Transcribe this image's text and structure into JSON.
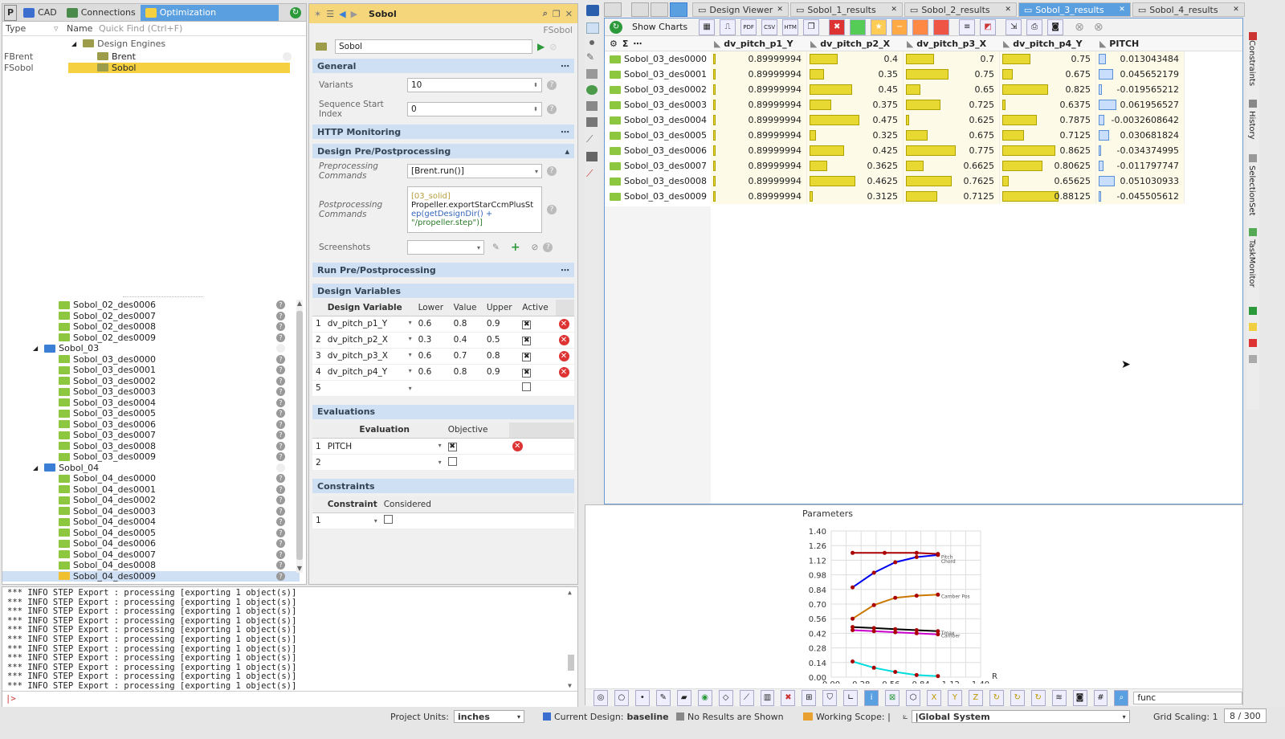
{
  "left": {
    "tabs": [
      "P",
      "CAD",
      "Connections",
      "Optimization"
    ],
    "tree_header": {
      "type": "Type",
      "name": "Name",
      "quick_find": "Quick Find (Ctrl+F)"
    },
    "engines": {
      "root": "Design Engines",
      "items": [
        {
          "type": "FBrent",
          "name": "Brent"
        },
        {
          "type": "FSobol",
          "name": "Sobol"
        }
      ]
    },
    "designs": [
      {
        "name": "Sobol_02_des0006",
        "kind": "item"
      },
      {
        "name": "Sobol_02_des0007",
        "kind": "item"
      },
      {
        "name": "Sobol_02_des0008",
        "kind": "item"
      },
      {
        "name": "Sobol_02_des0009",
        "kind": "item"
      },
      {
        "name": "Sobol_03",
        "kind": "group"
      },
      {
        "name": "Sobol_03_des0000",
        "kind": "item"
      },
      {
        "name": "Sobol_03_des0001",
        "kind": "item"
      },
      {
        "name": "Sobol_03_des0002",
        "kind": "item"
      },
      {
        "name": "Sobol_03_des0003",
        "kind": "item"
      },
      {
        "name": "Sobol_03_des0004",
        "kind": "item"
      },
      {
        "name": "Sobol_03_des0005",
        "kind": "item"
      },
      {
        "name": "Sobol_03_des0006",
        "kind": "item"
      },
      {
        "name": "Sobol_03_des0007",
        "kind": "item"
      },
      {
        "name": "Sobol_03_des0008",
        "kind": "item"
      },
      {
        "name": "Sobol_03_des0009",
        "kind": "item"
      },
      {
        "name": "Sobol_04",
        "kind": "group"
      },
      {
        "name": "Sobol_04_des0000",
        "kind": "item"
      },
      {
        "name": "Sobol_04_des0001",
        "kind": "item"
      },
      {
        "name": "Sobol_04_des0002",
        "kind": "item"
      },
      {
        "name": "Sobol_04_des0003",
        "kind": "item"
      },
      {
        "name": "Sobol_04_des0004",
        "kind": "item"
      },
      {
        "name": "Sobol_04_des0005",
        "kind": "item"
      },
      {
        "name": "Sobol_04_des0006",
        "kind": "item"
      },
      {
        "name": "Sobol_04_des0007",
        "kind": "item"
      },
      {
        "name": "Sobol_04_des0008",
        "kind": "item"
      },
      {
        "name": "Sobol_04_des0009",
        "kind": "item"
      }
    ]
  },
  "console": {
    "lines": [
      "*** INFO STEP Export : processing [exporting 1 object(s)]",
      "*** INFO STEP Export : processing [exporting 1 object(s)]",
      "*** INFO STEP Export : processing [exporting 1 object(s)]",
      "*** INFO STEP Export : processing [exporting 1 object(s)]",
      "*** INFO STEP Export : processing [exporting 1 object(s)]",
      "*** INFO STEP Export : processing [exporting 1 object(s)]",
      "*** INFO STEP Export : processing [exporting 1 object(s)]",
      "*** INFO STEP Export : processing [exporting 1 object(s)]",
      "*** INFO STEP Export : processing [exporting 1 object(s)]",
      "*** INFO STEP Export : processing [exporting 1 object(s)]",
      "*** INFO STEP Export : processing [exporting 1 object(s)]"
    ],
    "prompt": "|>"
  },
  "mid": {
    "title": "Sobol",
    "class_label": "FSobol",
    "name_value": "Sobol",
    "general": "General",
    "variants_label": "Variants",
    "variants_value": "10",
    "seq_label": "Sequence Start Index",
    "seq_value": "0",
    "http": "HTTP Monitoring",
    "prepost": "Design Pre/Postprocessing",
    "pre_label": "Preprocessing Commands",
    "pre_value": "[Brent.run()]",
    "post_label": "Postprocessing Commands",
    "post_value_1": "[03_solid]",
    "post_value_2": "Propeller.exportStarCcmPlusSt",
    "post_value_3": "ep(getDesignDir() +",
    "post_value_4": "\"/propeller.step\")]",
    "screenshots_label": "Screenshots",
    "runprepost": "Run Pre/Postprocessing",
    "designvars": "Design Variables",
    "dv_headers": [
      "Design Variable",
      "Lower",
      "Value",
      "Upper",
      "Active"
    ],
    "dv_rows": [
      {
        "idx": "1",
        "name": "dv_pitch_p1_Y",
        "lower": "0.6",
        "value": "0.8",
        "upper": "0.9"
      },
      {
        "idx": "2",
        "name": "dv_pitch_p2_X",
        "lower": "0.3",
        "value": "0.4",
        "upper": "0.5"
      },
      {
        "idx": "3",
        "name": "dv_pitch_p3_X",
        "lower": "0.6",
        "value": "0.7",
        "upper": "0.8"
      },
      {
        "idx": "4",
        "name": "dv_pitch_p4_Y",
        "lower": "0.6",
        "value": "0.8",
        "upper": "0.9"
      }
    ],
    "dv_empty_idx": "5",
    "evaluations": "Evaluations",
    "ev_headers": [
      "Evaluation",
      "Objective"
    ],
    "ev_rows": [
      {
        "idx": "1",
        "name": "PITCH"
      }
    ],
    "ev_empty_idx": "2",
    "constraints": "Constraints",
    "con_headers": [
      "Constraint",
      "Considered"
    ],
    "con_empty_idx": "1"
  },
  "right_tabs": [
    "Design Viewer",
    "Sobol_1_results",
    "Sobol_2_results",
    "Sobol_3_results",
    "Sobol_4_results"
  ],
  "results": {
    "show_charts": "Show Charts",
    "headers": [
      "dv_pitch_p1_Y",
      "dv_pitch_p2_X",
      "dv_pitch_p3_X",
      "dv_pitch_p4_Y",
      "PITCH"
    ],
    "rows": [
      {
        "name": "Sobol_03_des0000",
        "p1": "0.89999994",
        "p2": "0.4",
        "p3": "0.7",
        "p4": "0.75",
        "pitch": "0.013043484",
        "f2": 0.5,
        "f3": 0.5,
        "f4": 0.5,
        "fp": 0.42
      },
      {
        "name": "Sobol_03_des0001",
        "p1": "0.89999994",
        "p2": "0.35",
        "p3": "0.75",
        "p4": "0.675",
        "pitch": "0.045652179",
        "f2": 0.25,
        "f3": 0.75,
        "f4": 0.19,
        "fp": 0.82
      },
      {
        "name": "Sobol_03_des0002",
        "p1": "0.89999994",
        "p2": "0.45",
        "p3": "0.65",
        "p4": "0.825",
        "pitch": "-0.019565212",
        "f2": 0.75,
        "f3": 0.25,
        "f4": 0.81,
        "fp": 0.2
      },
      {
        "name": "Sobol_03_des0003",
        "p1": "0.89999994",
        "p2": "0.375",
        "p3": "0.725",
        "p4": "0.6375",
        "pitch": "0.061956527",
        "f2": 0.38,
        "f3": 0.62,
        "f4": 0.06,
        "fp": 1.0
      },
      {
        "name": "Sobol_03_des0004",
        "p1": "0.89999994",
        "p2": "0.475",
        "p3": "0.625",
        "p4": "0.7875",
        "pitch": "-0.0032608642",
        "f2": 0.88,
        "f3": 0.06,
        "f4": 0.62,
        "fp": 0.3
      },
      {
        "name": "Sobol_03_des0005",
        "p1": "0.89999994",
        "p2": "0.325",
        "p3": "0.675",
        "p4": "0.7125",
        "pitch": "0.030681824",
        "f2": 0.12,
        "f3": 0.38,
        "f4": 0.38,
        "fp": 0.6
      },
      {
        "name": "Sobol_03_des0006",
        "p1": "0.89999994",
        "p2": "0.425",
        "p3": "0.775",
        "p4": "0.8625",
        "pitch": "-0.034374995",
        "f2": 0.62,
        "f3": 0.88,
        "f4": 0.94,
        "fp": 0.1
      },
      {
        "name": "Sobol_03_des0007",
        "p1": "0.89999994",
        "p2": "0.3625",
        "p3": "0.6625",
        "p4": "0.80625",
        "pitch": "-0.011797747",
        "f2": 0.31,
        "f3": 0.31,
        "f4": 0.72,
        "fp": 0.25
      },
      {
        "name": "Sobol_03_des0008",
        "p1": "0.89999994",
        "p2": "0.4625",
        "p3": "0.7625",
        "p4": "0.65625",
        "pitch": "0.051030933",
        "f2": 0.81,
        "f3": 0.81,
        "f4": 0.12,
        "fp": 0.9
      },
      {
        "name": "Sobol_03_des0009",
        "p1": "0.89999994",
        "p2": "0.3125",
        "p3": "0.7125",
        "p4": "0.88125",
        "pitch": "-0.045505612",
        "f2": 0.06,
        "f3": 0.56,
        "f4": 1.0,
        "fp": 0.05
      }
    ]
  },
  "params_title": "Parameters",
  "chart_data": {
    "type": "line",
    "title": "Parameters",
    "xlabel": "R",
    "ylim": [
      0.0,
      1.4
    ],
    "xlim": [
      0.0,
      1.4
    ],
    "yticks": [
      "1.40",
      "1.26",
      "1.12",
      "0.98",
      "0.84",
      "0.70",
      "0.56",
      "0.42",
      "0.28",
      "0.14",
      "0.00"
    ],
    "xticks": [
      "0.00",
      "0.28",
      "0.56",
      "0.84",
      "1.12",
      "1.40"
    ],
    "series": [
      {
        "name": "Pitch",
        "color": "#aa0000",
        "x": [
          0.2,
          0.5,
          0.8,
          1.0
        ],
        "y": [
          1.19,
          1.19,
          1.19,
          1.18
        ]
      },
      {
        "name": "Chord",
        "color": "#0000ee",
        "x": [
          0.2,
          0.4,
          0.6,
          0.8,
          1.0
        ],
        "y": [
          0.86,
          1.0,
          1.1,
          1.15,
          1.17
        ]
      },
      {
        "name": "Camber Pos",
        "color": "#cc7700",
        "x": [
          0.2,
          0.4,
          0.6,
          0.8,
          1.0
        ],
        "y": [
          0.56,
          0.69,
          0.76,
          0.78,
          0.79
        ]
      },
      {
        "name": "Tmax",
        "color": "#000000",
        "x": [
          0.2,
          0.4,
          0.6,
          0.8,
          1.0
        ],
        "y": [
          0.48,
          0.47,
          0.46,
          0.45,
          0.44
        ]
      },
      {
        "name": "Camber",
        "color": "#cc00cc",
        "x": [
          0.2,
          0.4,
          0.6,
          0.8,
          1.0
        ],
        "y": [
          0.45,
          0.44,
          0.43,
          0.42,
          0.41
        ]
      },
      {
        "name": "",
        "color": "#00dddd",
        "x": [
          0.2,
          0.4,
          0.6,
          0.8,
          1.0
        ],
        "y": [
          0.15,
          0.09,
          0.05,
          0.02,
          0.01
        ]
      }
    ]
  },
  "params_search": "func",
  "sidebar_right": [
    "Constraints",
    "History",
    "SelectionSet",
    "TaskMonitor"
  ],
  "status": {
    "units_label": "Project Units:",
    "units_value": "inches",
    "current_design": "Current Design:",
    "current_design_value": "baseline",
    "no_results": "No Results are Shown",
    "working_scope": "Working Scope: |",
    "scope_value": "|Global System",
    "grid_scaling": "Grid Scaling: 1",
    "counter": "8 / 300"
  }
}
